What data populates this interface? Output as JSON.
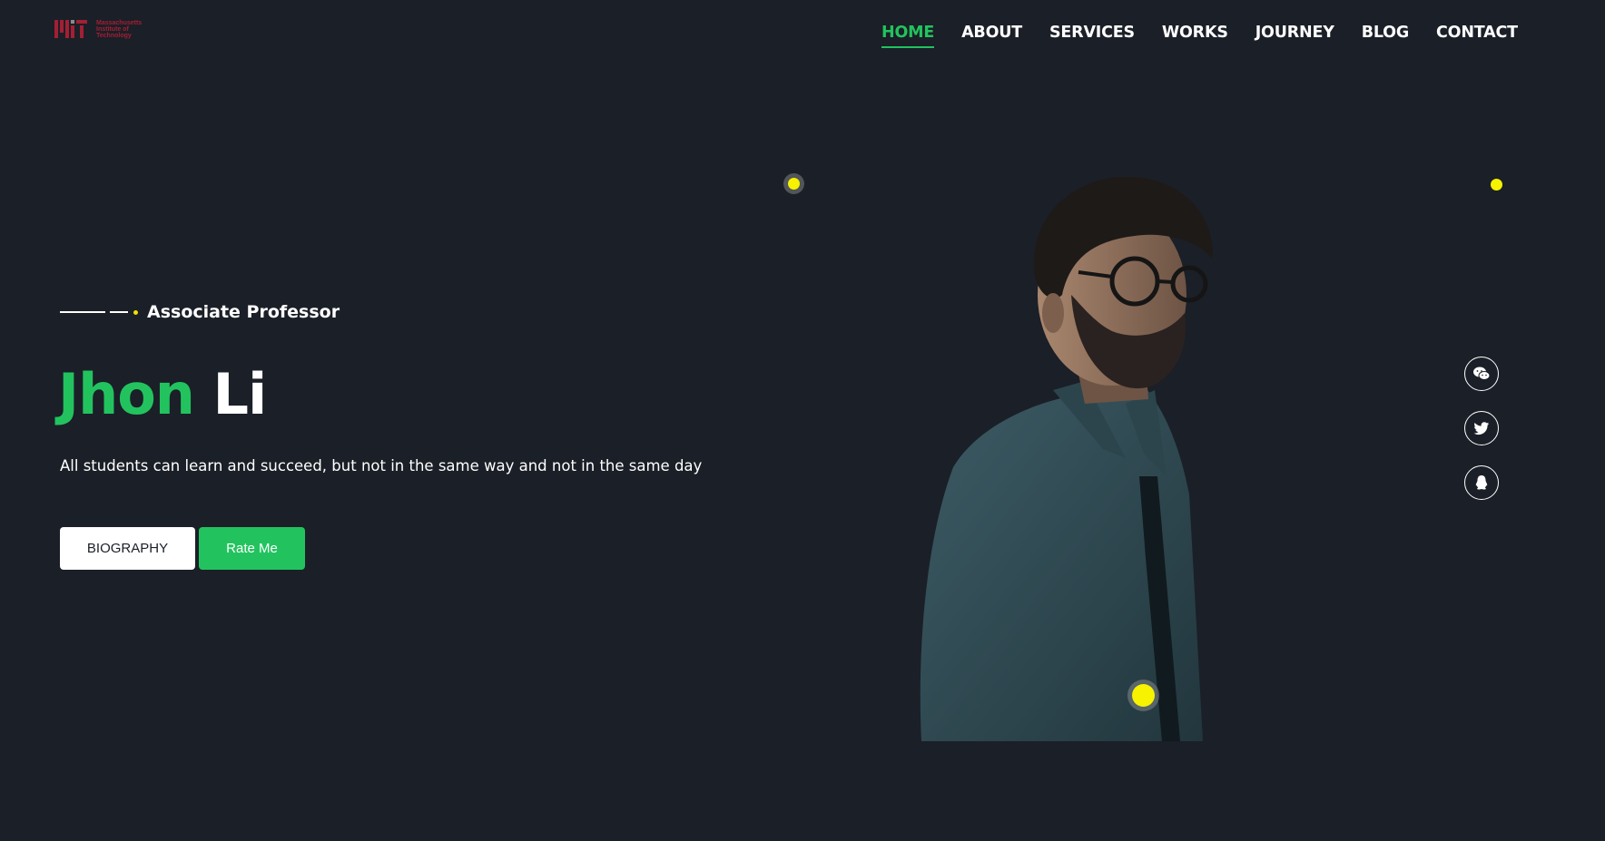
{
  "logo": {
    "lines": [
      "Massachusetts",
      "Institute of",
      "Technology"
    ],
    "color": "#a31f34"
  },
  "nav": {
    "items": [
      {
        "label": "HOME",
        "active": true
      },
      {
        "label": "ABOUT",
        "active": false
      },
      {
        "label": "SERVICES",
        "active": false
      },
      {
        "label": "WORKS",
        "active": false
      },
      {
        "label": "JOURNEY",
        "active": false
      },
      {
        "label": "BLOG",
        "active": false
      },
      {
        "label": "CONTACT",
        "active": false
      }
    ]
  },
  "hero": {
    "subtitle": "Associate Professor",
    "name_first": "Jhon",
    "name_last": "Li",
    "tagline": "All students can learn and succeed, but not in the same way and not in the same day",
    "buttons": {
      "biography": "BIOGRAPHY",
      "rate": "Rate Me"
    }
  },
  "social": {
    "icons": [
      "wechat-icon",
      "twitter-icon",
      "qq-icon"
    ]
  },
  "colors": {
    "background": "#1b1f27",
    "accent": "#22c35e",
    "highlight": "#f6f200"
  }
}
